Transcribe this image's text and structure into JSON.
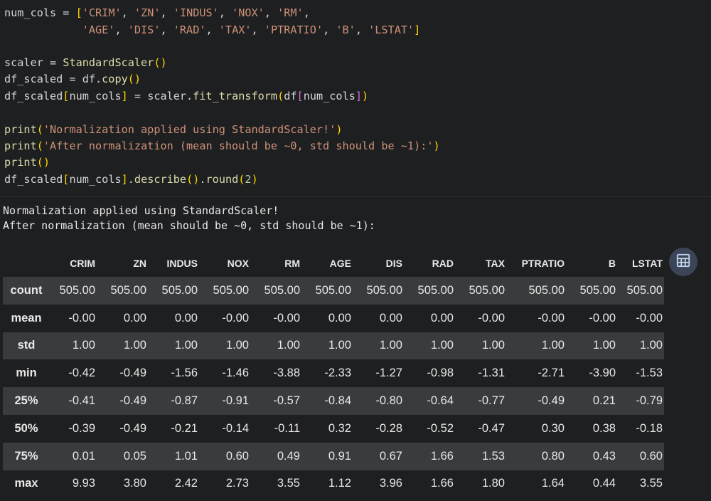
{
  "code": {
    "lines": [
      [
        [
          "plain",
          "num_cols = "
        ],
        [
          "br",
          "["
        ],
        [
          "str",
          "'CRIM'"
        ],
        [
          "plain",
          ", "
        ],
        [
          "str",
          "'ZN'"
        ],
        [
          "plain",
          ", "
        ],
        [
          "str",
          "'INDUS'"
        ],
        [
          "plain",
          ", "
        ],
        [
          "str",
          "'NOX'"
        ],
        [
          "plain",
          ", "
        ],
        [
          "str",
          "'RM'"
        ],
        [
          "plain",
          ","
        ]
      ],
      [
        [
          "plain",
          "            "
        ],
        [
          "str",
          "'AGE'"
        ],
        [
          "plain",
          ", "
        ],
        [
          "str",
          "'DIS'"
        ],
        [
          "plain",
          ", "
        ],
        [
          "str",
          "'RAD'"
        ],
        [
          "plain",
          ", "
        ],
        [
          "str",
          "'TAX'"
        ],
        [
          "plain",
          ", "
        ],
        [
          "str",
          "'PTRATIO'"
        ],
        [
          "plain",
          ", "
        ],
        [
          "str",
          "'B'"
        ],
        [
          "plain",
          ", "
        ],
        [
          "str",
          "'LSTAT'"
        ],
        [
          "br",
          "]"
        ]
      ],
      [],
      [
        [
          "plain",
          "scaler = "
        ],
        [
          "fn",
          "StandardScaler"
        ],
        [
          "br",
          "()"
        ]
      ],
      [
        [
          "plain",
          "df_scaled = df."
        ],
        [
          "fn",
          "copy"
        ],
        [
          "br",
          "()"
        ]
      ],
      [
        [
          "plain",
          "df_scaled"
        ],
        [
          "br",
          "["
        ],
        [
          "plain",
          "num_cols"
        ],
        [
          "br",
          "]"
        ],
        [
          "plain",
          " = scaler."
        ],
        [
          "fn",
          "fit_transform"
        ],
        [
          "br",
          "("
        ],
        [
          "plain",
          "df"
        ],
        [
          "br2",
          "["
        ],
        [
          "plain",
          "num_cols"
        ],
        [
          "br2",
          "]"
        ],
        [
          "br",
          ")"
        ]
      ],
      [],
      [
        [
          "fn",
          "print"
        ],
        [
          "br",
          "("
        ],
        [
          "str",
          "'Normalization applied using StandardScaler!'"
        ],
        [
          "br",
          ")"
        ]
      ],
      [
        [
          "fn",
          "print"
        ],
        [
          "br",
          "("
        ],
        [
          "str",
          "'After normalization (mean should be ~0, std should be ~1):'"
        ],
        [
          "br",
          ")"
        ]
      ],
      [
        [
          "fn",
          "print"
        ],
        [
          "br",
          "()"
        ]
      ],
      [
        [
          "plain",
          "df_scaled"
        ],
        [
          "br",
          "["
        ],
        [
          "plain",
          "num_cols"
        ],
        [
          "br",
          "]"
        ],
        [
          "plain",
          "."
        ],
        [
          "fn",
          "describe"
        ],
        [
          "br",
          "()"
        ],
        [
          "plain",
          "."
        ],
        [
          "fn",
          "round"
        ],
        [
          "br",
          "("
        ],
        [
          "num",
          "2"
        ],
        [
          "br",
          ")"
        ]
      ]
    ]
  },
  "output": {
    "line1": "Normalization applied using StandardScaler!",
    "line2": "After normalization (mean should be ~0, std should be ~1):"
  },
  "table": {
    "columns": [
      "CRIM",
      "ZN",
      "INDUS",
      "NOX",
      "RM",
      "AGE",
      "DIS",
      "RAD",
      "TAX",
      "PTRATIO",
      "B",
      "LSTAT"
    ],
    "rows": [
      {
        "label": "count",
        "values": [
          "505.00",
          "505.00",
          "505.00",
          "505.00",
          "505.00",
          "505.00",
          "505.00",
          "505.00",
          "505.00",
          "505.00",
          "505.00",
          "505.00"
        ]
      },
      {
        "label": "mean",
        "values": [
          "-0.00",
          "0.00",
          "0.00",
          "-0.00",
          "-0.00",
          "0.00",
          "0.00",
          "0.00",
          "-0.00",
          "-0.00",
          "-0.00",
          "-0.00"
        ]
      },
      {
        "label": "std",
        "values": [
          "1.00",
          "1.00",
          "1.00",
          "1.00",
          "1.00",
          "1.00",
          "1.00",
          "1.00",
          "1.00",
          "1.00",
          "1.00",
          "1.00"
        ]
      },
      {
        "label": "min",
        "values": [
          "-0.42",
          "-0.49",
          "-1.56",
          "-1.46",
          "-3.88",
          "-2.33",
          "-1.27",
          "-0.98",
          "-1.31",
          "-2.71",
          "-3.90",
          "-1.53"
        ]
      },
      {
        "label": "25%",
        "values": [
          "-0.41",
          "-0.49",
          "-0.87",
          "-0.91",
          "-0.57",
          "-0.84",
          "-0.80",
          "-0.64",
          "-0.77",
          "-0.49",
          "0.21",
          "-0.79"
        ]
      },
      {
        "label": "50%",
        "values": [
          "-0.39",
          "-0.49",
          "-0.21",
          "-0.14",
          "-0.11",
          "0.32",
          "-0.28",
          "-0.52",
          "-0.47",
          "0.30",
          "0.38",
          "-0.18"
        ]
      },
      {
        "label": "75%",
        "values": [
          "0.01",
          "0.05",
          "1.01",
          "0.60",
          "0.49",
          "0.91",
          "0.67",
          "1.66",
          "1.53",
          "0.80",
          "0.43",
          "0.60"
        ]
      },
      {
        "label": "max",
        "values": [
          "9.93",
          "3.80",
          "2.42",
          "2.73",
          "3.55",
          "1.12",
          "3.96",
          "1.66",
          "1.80",
          "1.64",
          "0.44",
          "3.55"
        ]
      }
    ]
  },
  "toolbar": {
    "table_icon": "table-grid-icon"
  },
  "colors": {
    "background": "#1e1f21",
    "stripe": "#3a3b3d",
    "string": "#ce9178",
    "function": "#dcdcaa",
    "bracket": "#ffd700",
    "bracket_nested": "#da70d6",
    "number": "#b5cea8",
    "button": "#3b4557"
  }
}
